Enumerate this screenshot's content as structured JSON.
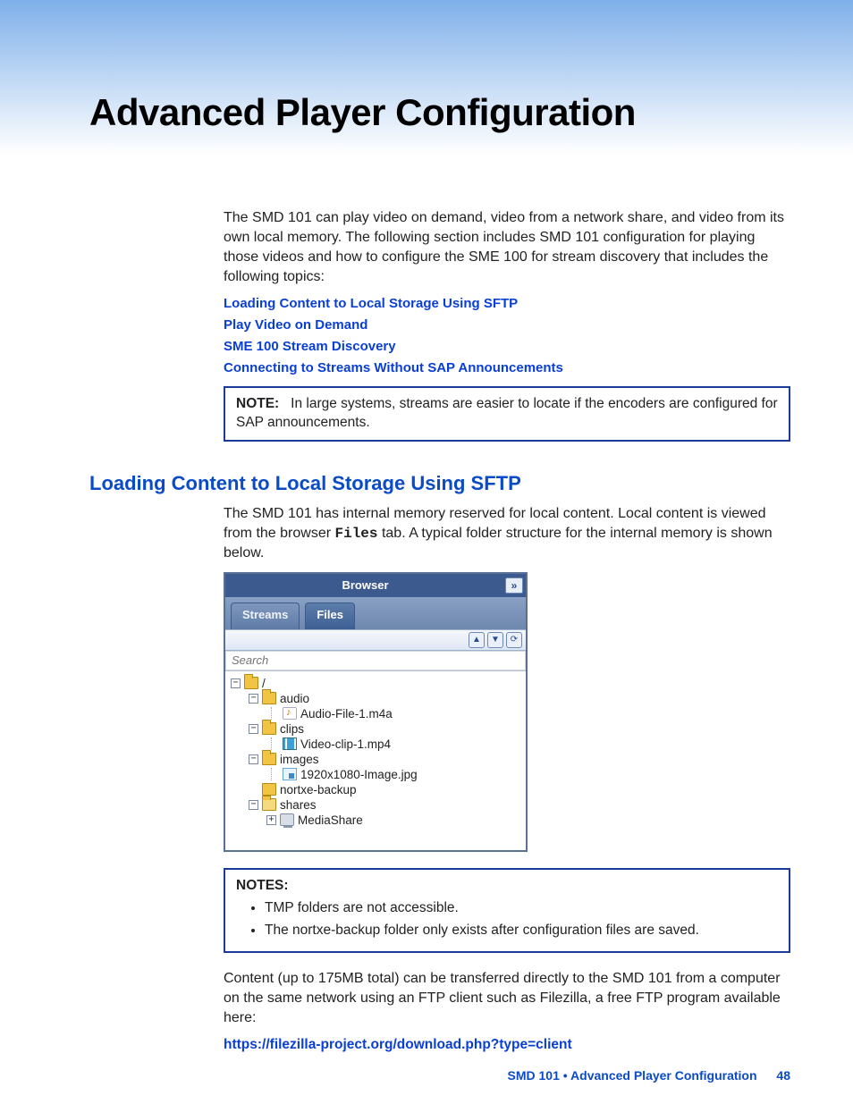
{
  "title": "Advanced Player Configuration",
  "intro": "The SMD 101 can play video on demand, video from a network share, and video from its own local memory. The following section includes SMD 101 configuration for playing those videos and how to configure the SME 100 for stream discovery that includes the following topics:",
  "topic_links": [
    "Loading Content to Local Storage Using SFTP",
    "Play Video on Demand",
    "SME 100 Stream Discovery",
    "Connecting to Streams Without SAP Announcements"
  ],
  "note1_label": "NOTE:",
  "note1_text": "In large systems, streams are easier to locate if the encoders are configured for SAP announcements.",
  "section_heading": "Loading Content to Local Storage Using SFTP",
  "section_p1a": "The SMD 101 has internal memory reserved for local content. Local content is viewed from the browser ",
  "section_p1_mono": "Files",
  "section_p1b": " tab. A typical folder structure for the internal memory is shown below.",
  "browser": {
    "title": "Browser",
    "collapse_glyph": "»",
    "tabs": {
      "streams": "Streams",
      "files": "Files"
    },
    "toolbar_glyphs": [
      "▲",
      "▼",
      "⟳"
    ],
    "search_placeholder": "Search",
    "tree": {
      "root": "/",
      "audio": {
        "label": "audio",
        "file": "Audio-File-1.m4a"
      },
      "clips": {
        "label": "clips",
        "file": "Video-clip-1.mp4"
      },
      "images": {
        "label": "images",
        "file": "1920x1080-Image.jpg"
      },
      "nortxe": "nortxe-backup",
      "shares": {
        "label": "shares",
        "child": "MediaShare"
      }
    }
  },
  "notes2_label": "NOTES:",
  "notes2_items": [
    "TMP folders are not accessible.",
    "The nortxe-backup folder only exists after configuration files are saved."
  ],
  "para_after": "Content (up to 175MB total) can be transferred directly to the SMD 101 from a computer on the same network using an FTP client such as Filezilla, a free FTP program available here:",
  "ext_link": "https://filezilla-project.org/download.php?type=client",
  "footer": {
    "doc": "SMD 101 • Advanced Player Configuration",
    "page": "48"
  }
}
